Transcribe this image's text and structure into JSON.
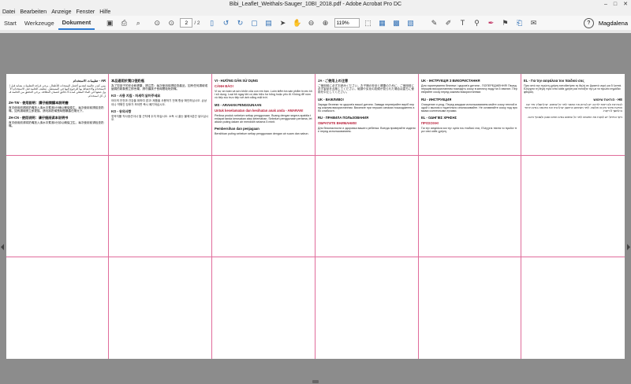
{
  "window": {
    "title": "Bibi_Leaflet_Weithals-Sauger_10BI_2018.pdf - Adobe Acrobat Pro DC",
    "controls": [
      "–",
      "□",
      "✕"
    ]
  },
  "menu": [
    "Datei",
    "Bearbeiten",
    "Anzeige",
    "Fenster",
    "Hilfe"
  ],
  "nav_tabs": {
    "start": "Start",
    "tools": "Werkzeuge",
    "document": "Dokument"
  },
  "toolbar": {
    "page_current": "2",
    "page_total": "/ 2",
    "zoom": "119%",
    "user": "Magdalena",
    "help": "?"
  },
  "columns": [
    {
      "heading": "AR - تعليمات الاستخدام",
      "text": "بيبي كيدز عالمية لتقديم أفضل المنتجات للأطفال. يرجى قراءة التعليمات بعناية قبل الاستخدام والاحتفاظ بها للرجوع إليها في المستقبل. تنظيف الحلمة قبل الاستخدام الأول ضعها في الماء المغلي لمدة 5 دقائق لضمان النظافة. يرجى التحقق من الحلمة قبل كل استخدام.",
      "heading2": "ZH-TW - 使用說明：請仔細閱讀本說明書",
      "text2": "首次使用前請將奶嘴放入沸水中煮沸5分鐘以確保衛生。每次使用前請檢查奶嘴，如有損壞請立即更換。請勿將奶嘴長時間暴露在陽光下。",
      "heading3": "ZH-CN - 使用说明：请仔细阅读本说明书",
      "text3": "首次使用前请将奶嘴放入沸水中煮沸5分钟以确保卫生。每次使用前请检查奶嘴。"
    },
    {
      "heading": "本品適用於寬口徑奶瓶",
      "text": "為了您孩子的安全和健康，請注意：每次使用前請檢查產品，如有任何損壞或變弱的跡象應立即丟棄。請勿讓孩子長時間吸吮奶嘴。",
      "heading2": "KO - 사용 지침 - 자세히 읽어주세요",
      "text2": "아이의 안전과 건강을 위하여 경고! 제품을 사용하기 전에 항상 확인하십시오. 손상이나 약해진 징후가 보이면 즉시 폐기하십시오.",
      "heading3": "KO - 유의사항",
      "text3": "젖꼭지를 직사광선이나 열 근처에 두지 마십시오. 소독 시 끓는 물에 5분간 넣으십시오."
    },
    {
      "heading": "VI - HƯỚNG DẪN SỬ DỤNG",
      "heading_note": "CẢNH BÁO!",
      "text": "Vì sự an toàn và sức khỏe của con em bạn. Luôn kiểm tra sản phẩm trước khi sử dụng. Loại bỏ ngay khi có dấu hiệu hư hỏng hoặc yếu đi. Không để núm vú tiếp xúc trực tiếp với ánh nắng mặt trời.",
      "heading2": "MS - ARAHAN PENGGUNAAN",
      "heading2_note": "Untuk keselamatan dan kesihatan anak anda - AMARAN!",
      "text2": "Periksa produk sebelum setiap penggunaan. Buang dengan segera apabila terdapat tanda kerosakan atau kelemahan. Sebelum penggunaan pertama, letakkan puting dalam air mendidih selama 5 minit.",
      "heading3": "Pembersihan dan penjagaan",
      "text3": "Bersihkan puting sebelum setiap penggunaan dengan air suam dan sabun."
    },
    {
      "heading": "JA - ご使用上の注意",
      "text": "ご使用前に必ずお読みください。お子様の安全と健康のために、ご使用前に必ず製品を点検してください。破損や劣化の兆候が見られた場合は直ちに使用を中止してください。",
      "heading2": "UK - ВАЖЛИВО!",
      "text2": "Заради безпеки та здоров'я вашої дитини. Завжди перевіряйте виріб перед кожним використанням. Викиньте при перших ознаках пошкодження або слабкості.",
      "heading3": "RU - ПРАВИЛА ПОЛЬЗОВАНИЯ",
      "heading3_note": "ОБРАТИТЕ ВНИМАНИЕ!",
      "text3": "Для безопасности и здоровья вашего ребенка. Всегда проверяйте изделие перед использованием."
    },
    {
      "heading": "UK - ІНСТРУКЦІЯ З ВИКОРИСТАННЯ",
      "text": "Для гарантування безпеки і здоров'я дитини - ПОПЕРЕДЖЕННЯ! Перед першим використанням покладіть соску в киплячу воду на 5 хвилин. Перевіряйте соску перед кожним використанням.",
      "heading2": "RU - ИНСТРУКЦИЯ",
      "text2": "Очищение и уход. Перед каждым использованием мойте соску теплой водой с мылом и тщательно ополаскивайте. Не оставляйте соску под прямыми солнечными лучами.",
      "heading3": "EL - ΟΔΗΓΙΕΣ ΧΡΗΣΗΣ",
      "heading3_note": "ΠΡΟΣΟΧΗ!",
      "text3": "Για την ασφάλεια και την υγεία του παιδιού σας. Ελέγχετε πάντα το προϊόν πριν από κάθε χρήση."
    },
    {
      "heading": "EL - Για την ασφάλεια του παιδιού σας",
      "text": "Πριν από την πρώτη χρήση τοποθετήστε τη θηλή σε βραστό νερό για 5 λεπτά. Ελέγχετε τη θηλή πριν από κάθε χρήση και πετάξτε την με τα πρώτα σημάδια φθοράς.",
      "heading2": "HE - הוראות שימוש",
      "text2": "לבטיחות ולבריאות ילדכם. יש לבדוק את המוצר לפני כל שימוש. יש להשליך מיד עם הופעת סימני נזק או חולשה. לפני השימוש הראשון יש להניח את הפטמה במים רותחים למשך 5 דקות.",
      "heading3": "",
      "text3": "ניקוי וטיפול: יש לנקות את הפטמה לפני כל שימוש במים חמים וסבון ולשטוף היטב."
    }
  ]
}
